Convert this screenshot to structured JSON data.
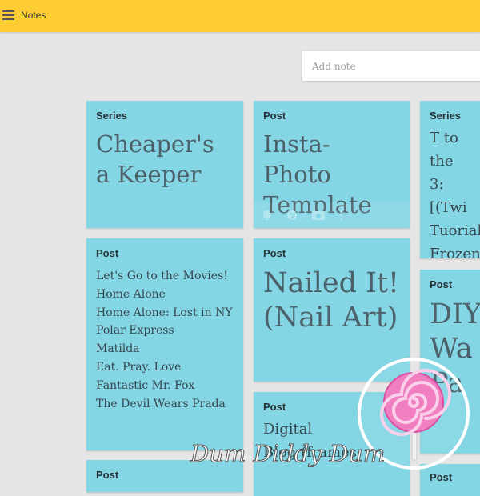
{
  "app": {
    "title": "Notes"
  },
  "add_note": {
    "placeholder": "Add note"
  },
  "colors": {
    "topbar": "#fdcd33",
    "card": "#85d6e5",
    "background": "#e5e5e5"
  },
  "cards": [
    {
      "type": "Series",
      "title": "Cheaper's a Keeper"
    },
    {
      "type": "Post",
      "title": "Insta- Photo Template",
      "tools": [
        "bell-icon",
        "palette-icon",
        "image-icon",
        "more-icon"
      ]
    },
    {
      "type": "Series",
      "lines": [
        "T to the",
        "3: [(Twi",
        "Tuorial",
        "Frozen"
      ]
    },
    {
      "type": "Post",
      "list": [
        "Let's Go to the Movies!",
        "Home Alone",
        "Home Alone: Lost in NY",
        "Polar Express",
        "Matilda",
        "Eat. Pray. Love",
        "Fantastic Mr. Fox",
        "The Devil Wears Prada"
      ]
    },
    {
      "type": "Post",
      "title": "Nailed It! (Nail Art)"
    },
    {
      "type": "Post",
      "title": "DIY Wa Pa"
    },
    {
      "type": "Post",
      "lines": [
        "Digital",
        "Blog (frames"
      ]
    },
    {
      "type": "Post"
    },
    {
      "type": "Post"
    }
  ],
  "watermark": {
    "text": "Dum Diddy Dum"
  }
}
